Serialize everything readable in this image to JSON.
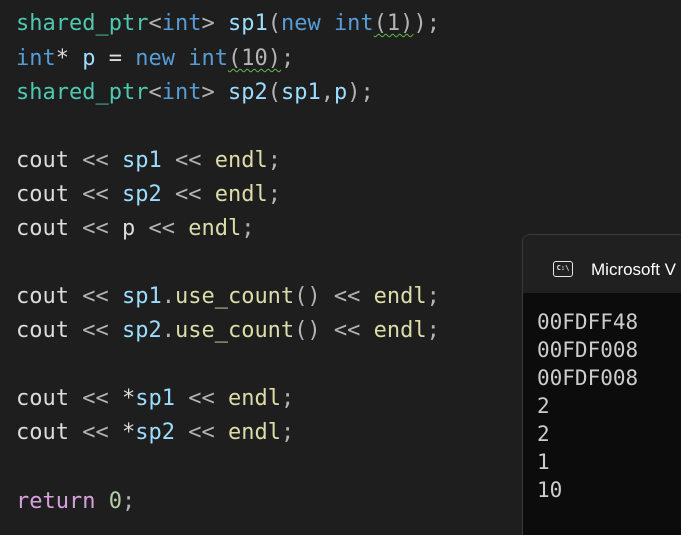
{
  "editor": {
    "lines": [
      {
        "tokens": [
          {
            "text": "shared_ptr",
            "kind": "type"
          },
          {
            "text": "<",
            "kind": "punct"
          },
          {
            "text": "int",
            "kind": "kw"
          },
          {
            "text": "> ",
            "kind": "punct"
          },
          {
            "text": "sp1",
            "kind": "var"
          },
          {
            "text": "(",
            "kind": "punct"
          },
          {
            "text": "new ",
            "kind": "kw"
          },
          {
            "text": "int",
            "kind": "kw"
          },
          {
            "text": "(1)",
            "kind": "squiggle"
          },
          {
            "text": ")",
            "kind": "punct"
          },
          {
            "text": ";",
            "kind": "punct"
          }
        ]
      },
      {
        "tokens": [
          {
            "text": "int",
            "kind": "kw"
          },
          {
            "text": "* ",
            "kind": "plain"
          },
          {
            "text": "p",
            "kind": "var"
          },
          {
            "text": " = ",
            "kind": "plain"
          },
          {
            "text": "new ",
            "kind": "kw"
          },
          {
            "text": "int",
            "kind": "kw"
          },
          {
            "text": "(10)",
            "kind": "squiggle"
          },
          {
            "text": ";",
            "kind": "punct"
          }
        ]
      },
      {
        "tokens": [
          {
            "text": "shared_ptr",
            "kind": "type"
          },
          {
            "text": "<",
            "kind": "punct"
          },
          {
            "text": "int",
            "kind": "kw"
          },
          {
            "text": "> ",
            "kind": "punct"
          },
          {
            "text": "sp2",
            "kind": "var"
          },
          {
            "text": "(",
            "kind": "punct"
          },
          {
            "text": "sp1",
            "kind": "var"
          },
          {
            "text": ",",
            "kind": "punct"
          },
          {
            "text": "p",
            "kind": "var"
          },
          {
            "text": ")",
            "kind": "punct"
          },
          {
            "text": ";",
            "kind": "punct"
          }
        ]
      },
      {
        "tokens": [
          {
            "text": "cout",
            "kind": "plain"
          },
          {
            "text": " << ",
            "kind": "punct"
          },
          {
            "text": "sp1",
            "kind": "var"
          },
          {
            "text": " << ",
            "kind": "punct"
          },
          {
            "text": "endl",
            "kind": "fn"
          },
          {
            "text": ";",
            "kind": "punct"
          }
        ]
      },
      {
        "tokens": [
          {
            "text": "cout",
            "kind": "plain"
          },
          {
            "text": " << ",
            "kind": "punct"
          },
          {
            "text": "sp2",
            "kind": "var"
          },
          {
            "text": " << ",
            "kind": "punct"
          },
          {
            "text": "endl",
            "kind": "fn"
          },
          {
            "text": ";",
            "kind": "punct"
          }
        ]
      },
      {
        "tokens": [
          {
            "text": "cout",
            "kind": "plain"
          },
          {
            "text": " << ",
            "kind": "punct"
          },
          {
            "text": "p",
            "kind": "plain"
          },
          {
            "text": " << ",
            "kind": "punct"
          },
          {
            "text": "endl",
            "kind": "fn"
          },
          {
            "text": ";",
            "kind": "punct"
          }
        ]
      },
      {
        "tokens": [
          {
            "text": "cout",
            "kind": "plain"
          },
          {
            "text": " << ",
            "kind": "punct"
          },
          {
            "text": "sp1",
            "kind": "var"
          },
          {
            "text": ".",
            "kind": "punct"
          },
          {
            "text": "use_count",
            "kind": "fn"
          },
          {
            "text": "()",
            "kind": "punct"
          },
          {
            "text": " << ",
            "kind": "punct"
          },
          {
            "text": "endl",
            "kind": "fn"
          },
          {
            "text": ";",
            "kind": "punct"
          }
        ]
      },
      {
        "tokens": [
          {
            "text": "cout",
            "kind": "plain"
          },
          {
            "text": " << ",
            "kind": "punct"
          },
          {
            "text": "sp2",
            "kind": "var"
          },
          {
            "text": ".",
            "kind": "punct"
          },
          {
            "text": "use_count",
            "kind": "fn"
          },
          {
            "text": "()",
            "kind": "punct"
          },
          {
            "text": " << ",
            "kind": "punct"
          },
          {
            "text": "endl",
            "kind": "fn"
          },
          {
            "text": ";",
            "kind": "punct"
          }
        ]
      },
      {
        "tokens": [
          {
            "text": "cout",
            "kind": "plain"
          },
          {
            "text": " << ",
            "kind": "punct"
          },
          {
            "text": "*",
            "kind": "plain"
          },
          {
            "text": "sp1",
            "kind": "var"
          },
          {
            "text": " << ",
            "kind": "punct"
          },
          {
            "text": "endl",
            "kind": "fn"
          },
          {
            "text": ";",
            "kind": "punct"
          }
        ]
      },
      {
        "tokens": [
          {
            "text": "cout",
            "kind": "plain"
          },
          {
            "text": " << ",
            "kind": "punct"
          },
          {
            "text": "*",
            "kind": "plain"
          },
          {
            "text": "sp2",
            "kind": "var"
          },
          {
            "text": " << ",
            "kind": "punct"
          },
          {
            "text": "endl",
            "kind": "fn"
          },
          {
            "text": ";",
            "kind": "punct"
          }
        ]
      },
      {
        "tokens": [
          {
            "text": "return",
            "kind": "ret"
          },
          {
            "text": " ",
            "kind": "plain"
          },
          {
            "text": "0",
            "kind": "num"
          },
          {
            "text": ";",
            "kind": "punct"
          }
        ]
      }
    ]
  },
  "console": {
    "icon": "terminal-icon",
    "icon_glyph": "C:\\",
    "title": "Microsoft V",
    "output": [
      "00FDFF48",
      "00FDF008",
      "00FDF008",
      "2",
      "2",
      "1",
      "10"
    ]
  }
}
